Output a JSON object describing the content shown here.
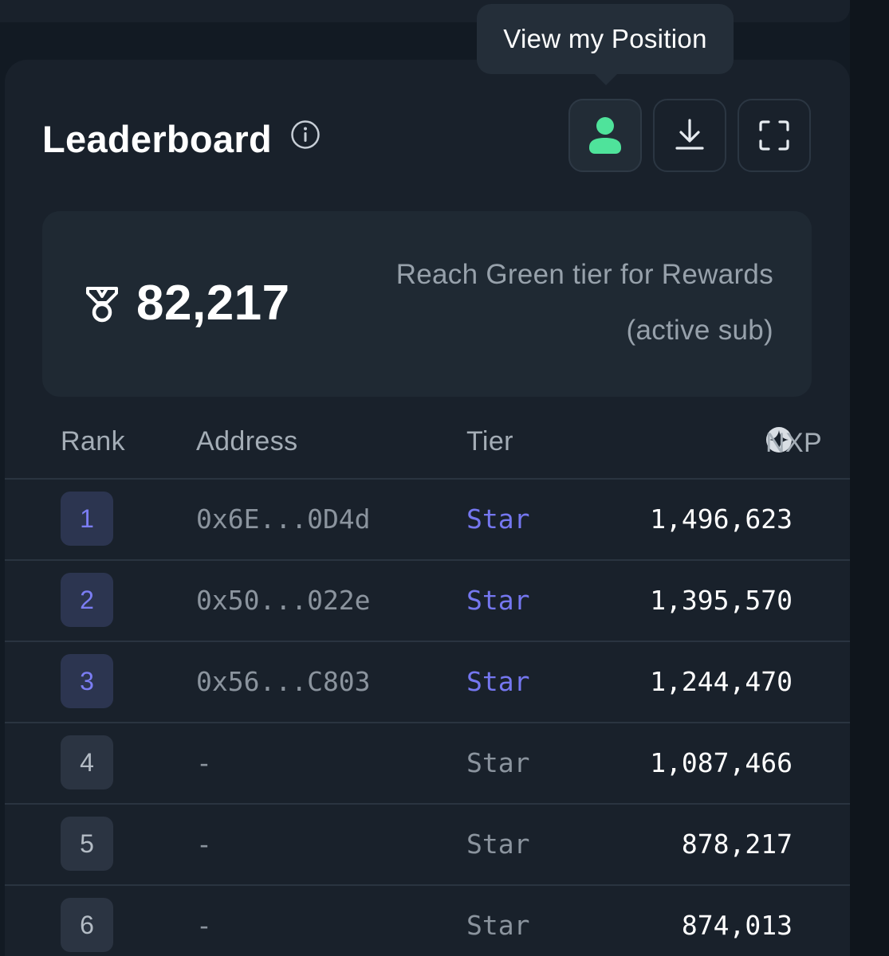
{
  "tooltip": {
    "text": "View my Position"
  },
  "leaderboard": {
    "title": "Leaderboard",
    "info_icon": "info-circle-icon",
    "buttons": [
      {
        "name": "view-position",
        "icon": "user-icon",
        "active": true,
        "icon_color": "#4fe39b"
      },
      {
        "name": "download",
        "icon": "download-icon",
        "active": false
      },
      {
        "name": "fullscreen",
        "icon": "fullscreen-icon",
        "active": false
      }
    ]
  },
  "score": {
    "icon": "medal-icon",
    "value": "82,217",
    "message_line1": "Reach Green tier for Rewards",
    "message_line2": "(active sub)"
  },
  "table": {
    "headers": {
      "rank": "Rank",
      "address": "Address",
      "tier": "Tier",
      "nxp": "NXP"
    },
    "nxp_icon": "sparkle-circle-icon",
    "rows": [
      {
        "rank": "1",
        "address": "0x6E...0D4d",
        "tier": "Star",
        "nxp": "1,496,623"
      },
      {
        "rank": "2",
        "address": "0x50...022e",
        "tier": "Star",
        "nxp": "1,395,570"
      },
      {
        "rank": "3",
        "address": "0x56...C803",
        "tier": "Star",
        "nxp": "1,244,470"
      },
      {
        "rank": "4",
        "address": "-",
        "tier": "Star",
        "nxp": "1,087,466"
      },
      {
        "rank": "5",
        "address": "-",
        "tier": "Star",
        "nxp": "878,217"
      },
      {
        "rank": "6",
        "address": "-",
        "tier": "Star",
        "nxp": "874,013"
      }
    ]
  },
  "colors": {
    "background": "#121a23",
    "card": "#19212b",
    "accent_purple": "#7577f0",
    "accent_green": "#4fe39b",
    "muted_text": "#8b949e"
  }
}
